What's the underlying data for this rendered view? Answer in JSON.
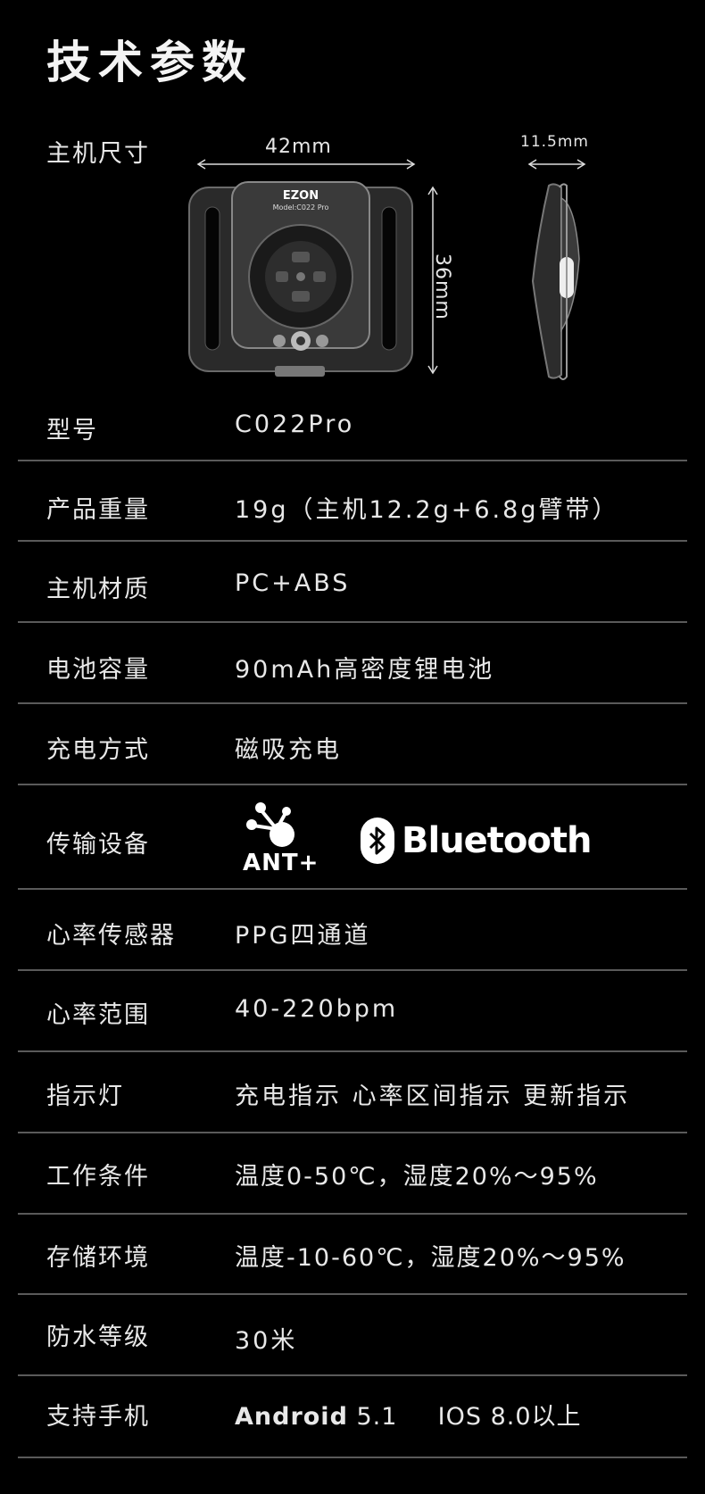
{
  "title": "技术参数",
  "size_section": {
    "label": "主机尺寸",
    "width_dim": "42mm",
    "height_dim": "36mm",
    "depth_dim": "11.5mm",
    "brand": "EZON",
    "model_text": "Model:C022 Pro"
  },
  "specs": [
    {
      "label": "型号",
      "value": "C022Pro"
    },
    {
      "label": "产品重量",
      "value": "19g（主机12.2g+6.8g臂带）"
    },
    {
      "label": "主机材质",
      "value": "PC+ABS"
    },
    {
      "label": "电池容量",
      "value": "90mAh高密度锂电池"
    },
    {
      "label": "充电方式",
      "value": "磁吸充电"
    },
    {
      "label": "传输设备",
      "ant_label": "ANT+",
      "bluetooth_label": "Bluetooth"
    },
    {
      "label": "心率传感器",
      "value": "PPG四通道"
    },
    {
      "label": "心率范围",
      "value": "40-220bpm"
    },
    {
      "label": "指示灯",
      "value": "充电指示 心率区间指示 更新指示"
    },
    {
      "label": "工作条件",
      "value": "温度0-50℃，湿度20%～95%"
    },
    {
      "label": "存储环境",
      "value": "温度-10-60℃，湿度20%～95%"
    },
    {
      "label": "防水等级",
      "value": "30米"
    },
    {
      "label": "支持手机",
      "android": "Android",
      "android_version": "5.1",
      "ios": "IOS",
      "ios_version": "8.0以上"
    }
  ],
  "icons": {
    "ant": "ant-plus-logo-icon",
    "bluetooth": "bluetooth-logo-icon"
  }
}
